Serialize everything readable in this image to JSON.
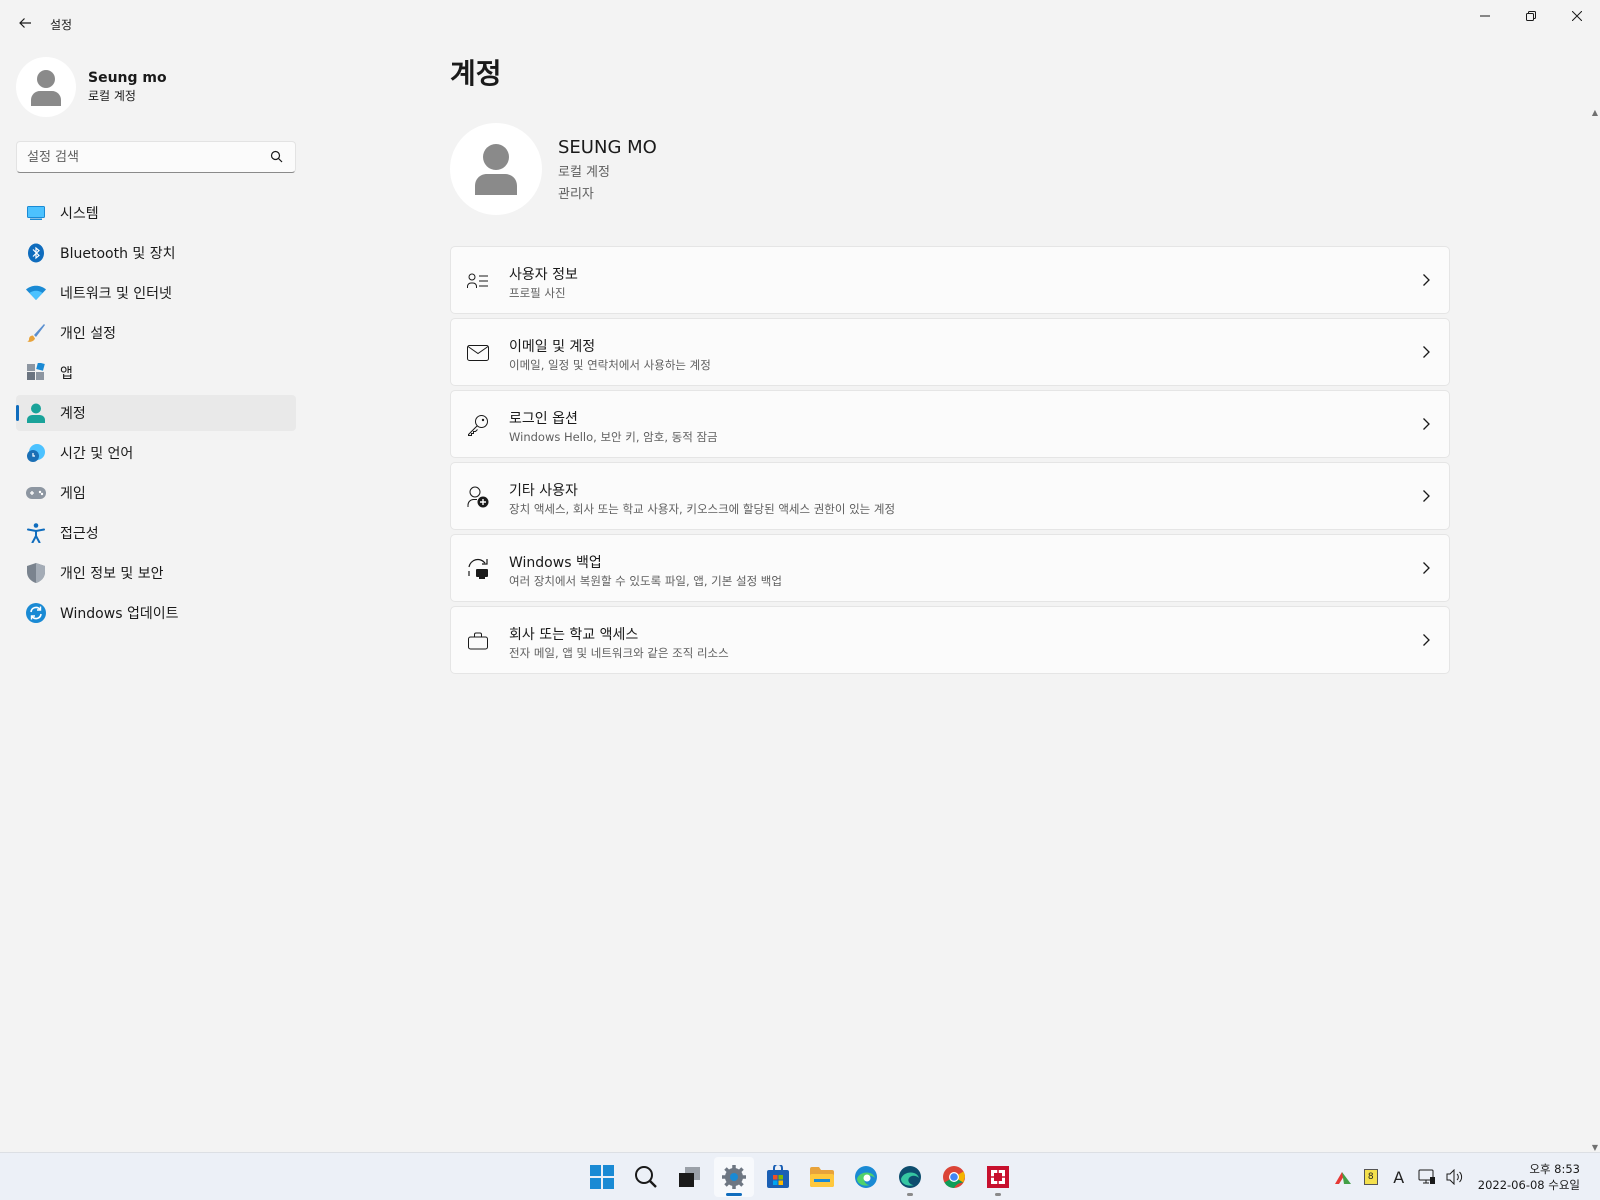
{
  "window": {
    "title": "설정"
  },
  "profile": {
    "name": "Seung mo",
    "type": "로컬 계정"
  },
  "search": {
    "placeholder": "설정 검색"
  },
  "nav": {
    "items": [
      {
        "label": "시스템",
        "icon": "monitor-icon"
      },
      {
        "label": "Bluetooth 및 장치",
        "icon": "bluetooth-icon"
      },
      {
        "label": "네트워크 및 인터넷",
        "icon": "wifi-icon"
      },
      {
        "label": "개인 설정",
        "icon": "paintbrush-icon"
      },
      {
        "label": "앱",
        "icon": "apps-icon"
      },
      {
        "label": "계정",
        "icon": "person-icon",
        "active": true
      },
      {
        "label": "시간 및 언어",
        "icon": "globe-clock-icon"
      },
      {
        "label": "게임",
        "icon": "gamepad-icon"
      },
      {
        "label": "접근성",
        "icon": "accessibility-icon"
      },
      {
        "label": "개인 정보 및 보안",
        "icon": "shield-icon"
      },
      {
        "label": "Windows 업데이트",
        "icon": "update-icon"
      }
    ]
  },
  "main": {
    "title": "계정",
    "account": {
      "name": "SEUNG MO",
      "type": "로컬 계정",
      "role": "관리자"
    },
    "cards": [
      {
        "title": "사용자 정보",
        "subtitle": "프로필 사진",
        "icon": "user-info-icon"
      },
      {
        "title": "이메일 및 계정",
        "subtitle": "이메일, 일정 및 연락처에서 사용하는 계정",
        "icon": "mail-icon"
      },
      {
        "title": "로그인 옵션",
        "subtitle": "Windows Hello, 보안 키, 암호, 동적 잠금",
        "icon": "key-icon"
      },
      {
        "title": "기타 사용자",
        "subtitle": "장치 액세스, 회사 또는 학교 사용자, 키오스크에 할당된 액세스 권한이 있는 계정",
        "icon": "add-person-icon"
      },
      {
        "title": "Windows 백업",
        "subtitle": "여러 장치에서 복원할 수 있도록 파일, 앱, 기본 설정 백업",
        "icon": "backup-icon"
      },
      {
        "title": "회사 또는 학교 액세스",
        "subtitle": "전자 메일, 앱 및 네트워크와 같은 조직 리소스",
        "icon": "briefcase-icon"
      }
    ]
  },
  "taskbar": {
    "apps": [
      "start-icon",
      "search-icon",
      "task-view-icon",
      "settings-icon",
      "store-icon",
      "file-explorer-icon",
      "edge-icon",
      "edge-dev-icon",
      "chrome-icon",
      "app-red-icon"
    ],
    "tray": {
      "ime_mode": "A",
      "badge": "8",
      "time": "오후 8:53",
      "date": "2022-06-08 수요일"
    }
  },
  "colors": {
    "accent": "#0f6cbd",
    "background": "#f3f3f3",
    "card": "#fbfbfb"
  }
}
